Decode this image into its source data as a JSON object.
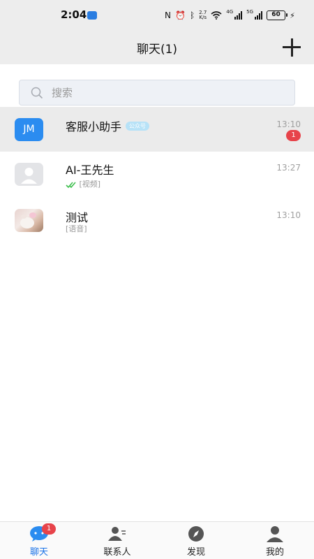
{
  "status_bar": {
    "time": "2:04",
    "speed_top": "2.7",
    "speed_unit": "K/s",
    "network_1": "4G",
    "network_2": "5G",
    "battery": "60"
  },
  "header": {
    "title": "聊天(1)",
    "add_icon": "plus-icon"
  },
  "search": {
    "placeholder": "搜索",
    "icon": "search-icon"
  },
  "chats": [
    {
      "name": "客服小助手",
      "avatar_text": "JM",
      "tag": "公众号",
      "time": "13:10",
      "unread": "1",
      "preview": ""
    },
    {
      "name": "AI-王先生",
      "avatar": "default-avatar",
      "time": "13:27",
      "preview": "[视频]",
      "status_icon": "double-check-icon"
    },
    {
      "name": "测试",
      "avatar": "photo-avatar",
      "time": "13:10",
      "preview": "[语音]"
    }
  ],
  "bottom_nav": [
    {
      "label": "聊天",
      "icon": "chat-bubble-icon",
      "badge": "1",
      "active": true
    },
    {
      "label": "联系人",
      "icon": "contacts-icon"
    },
    {
      "label": "发现",
      "icon": "compass-icon"
    },
    {
      "label": "我的",
      "icon": "person-icon"
    }
  ],
  "colors": {
    "accent": "#1a73e8",
    "badge": "#e7434a",
    "header_bg": "#ededed",
    "jm_avatar": "#2b8cf0",
    "check": "#3fbf4e"
  }
}
